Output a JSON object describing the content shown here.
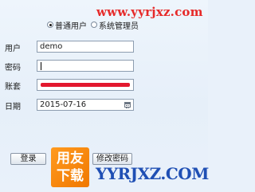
{
  "watermark_top": "www.yyrjxz.com",
  "user_type": {
    "options": [
      {
        "label": "普通用户",
        "selected": true
      },
      {
        "label": "系统管理员",
        "selected": false
      }
    ]
  },
  "form": {
    "username_label": "用户",
    "username_value": "demo",
    "password_label": "密码",
    "password_value": "",
    "account_label": "账套",
    "date_label": "日期",
    "date_value": "2015-07-16"
  },
  "buttons": {
    "login": "登录",
    "change_password": "修改密码"
  },
  "watermark_logo": {
    "line1": "用友",
    "line2": "下载"
  },
  "watermark_bottom": "YYRJXZ.COM",
  "colors": {
    "watermark_red": "#e62a2a",
    "watermark_blue": "#1f4fb4",
    "logo_orange": "#f07800",
    "redaction_red": "#e3182e"
  }
}
